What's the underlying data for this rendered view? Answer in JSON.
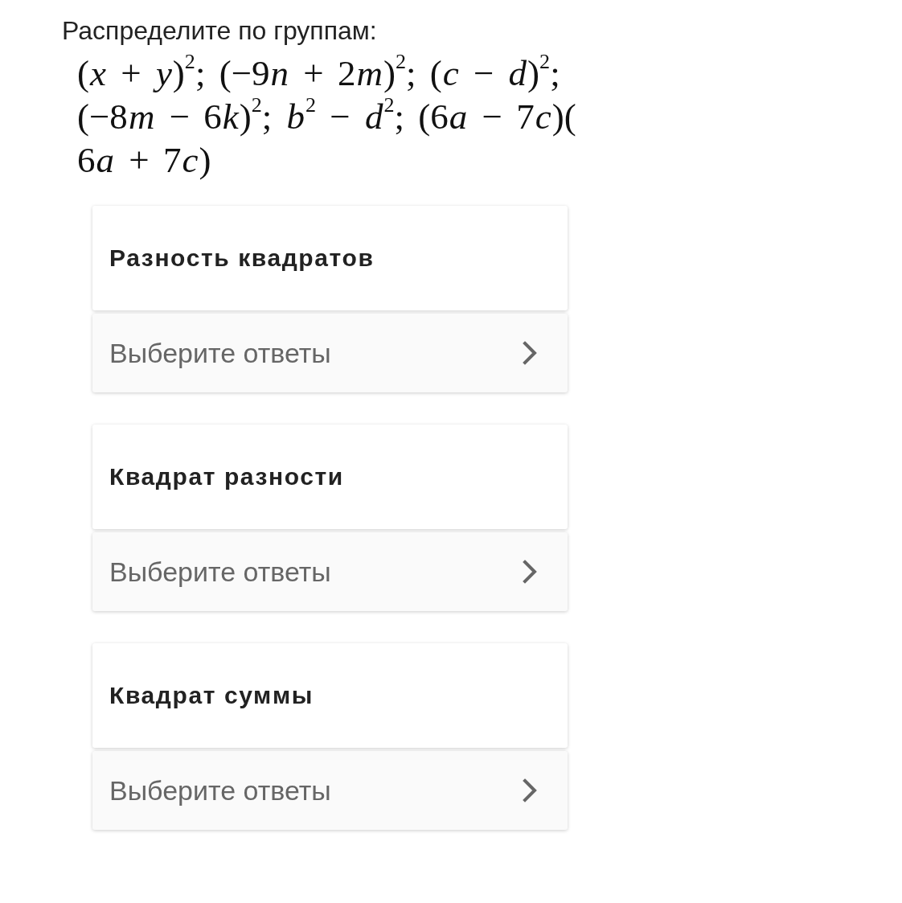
{
  "prompt": {
    "text": "Распределите по группам:"
  },
  "expression_lines": [
    "(x + y)$^{2}$; (−9n + 2m)$^{2}$; (c − d)$^{2}$;",
    "(−8m − 6k)$^{2}$; b$^{2}$ − d$^{2}$; (6a − 7c)(",
    "6a + 7c)"
  ],
  "groups": [
    {
      "title": "Разность квадратов",
      "select": {
        "placeholder": "Выберите ответы"
      }
    },
    {
      "title": "Квадрат разности",
      "select": {
        "placeholder": "Выберите ответы"
      }
    },
    {
      "title": "Квадрат суммы",
      "select": {
        "placeholder": "Выберите ответы"
      }
    }
  ]
}
